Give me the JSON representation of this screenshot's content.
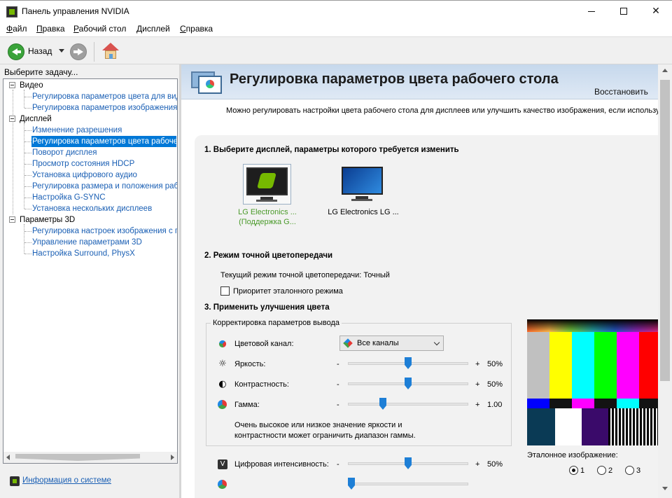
{
  "window": {
    "title": "Панель управления NVIDIA"
  },
  "menu": [
    "Файл",
    "Правка",
    "Рабочий стол",
    "Дисплей",
    "Справка"
  ],
  "toolbar": {
    "back_label": "Назад"
  },
  "left": {
    "task_header": "Выберите задачу...",
    "categories": [
      {
        "label": "Видео",
        "items": [
          "Регулировка параметров цвета для вид",
          "Регулировка параметров изображения д"
        ]
      },
      {
        "label": "Дисплей",
        "items": [
          "Изменение разрешения",
          "Регулировка параметров цвета рабочег",
          "Поворот дисплея",
          "Просмотр состояния HDCP",
          "Установка цифрового аудио",
          "Регулировка размера и положения рабо",
          "Настройка G-SYNC",
          "Установка нескольких дисплеев"
        ]
      },
      {
        "label": "Параметры 3D",
        "items": [
          "Регулировка настроек изображения с пр",
          "Управление параметрами 3D",
          "Настройка Surround, PhysX"
        ]
      }
    ],
    "selected_item": "Регулировка параметров цвета рабочег",
    "system_info": "Информация о системе"
  },
  "page": {
    "title": "Регулировка параметров цвета рабочего стола",
    "restore": "Восстановить",
    "description": "Можно регулировать настройки цвета рабочего стола для дисплеев или улучшить качество изображения, если использу",
    "section1": "1. Выберите дисплей, параметры которого требуется изменить",
    "displays": [
      {
        "line1": "LG Electronics ...",
        "line2": "(Поддержка G..."
      },
      {
        "line1": "LG Electronics LG ...",
        "line2": ""
      }
    ],
    "section2": "2. Режим точной цветопередачи",
    "current_mode": "Текущий режим точной цветопередачи: Точный",
    "reference_priority": "Приоритет эталонного режима",
    "section3": "3. Применить улучшения цвета",
    "group_title": "Корректировка параметров вывода",
    "channel_label": "Цветовой канал:",
    "channel_value": "Все каналы",
    "brightness_label": "Яркость:",
    "brightness_value": "50%",
    "contrast_label": "Контрастность:",
    "contrast_value": "50%",
    "gamma_label": "Гамма:",
    "gamma_value": "1.00",
    "note_line1": "Очень высокое или низкое значение яркости и",
    "note_line2": "контрастности может ограничить диапазон гаммы.",
    "digital_label": "Цифровая интенсивность:",
    "digital_value": "50%",
    "minus": "-",
    "plus": "+",
    "reference_image": "Эталонное изображение:",
    "radios": [
      "1",
      "2",
      "3"
    ]
  }
}
